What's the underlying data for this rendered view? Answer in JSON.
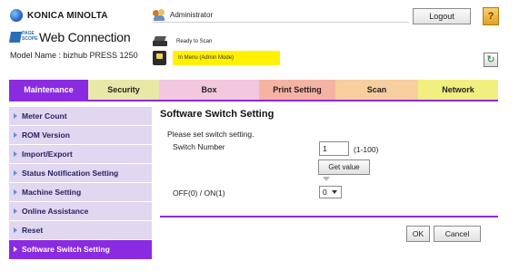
{
  "header": {
    "brand": "KONICA MINOLTA",
    "pagescope_logo": "PAGE SCOPE",
    "app_title": "Web Connection",
    "model_label": "Model Name : bizhub PRESS 1250",
    "user": "Administrator",
    "printer_status": "Ready to Scan",
    "menu_status": "In Menu (Admin Mode)",
    "logout_label": "Logout",
    "help_label": "?",
    "refresh_icon": "refresh-icon",
    "colors": {
      "menu_status_bg": "#fff200",
      "help_bg": "#e4a21e"
    }
  },
  "tabs": [
    {
      "label": "Maintenance",
      "color": "#8a2be2",
      "active": true
    },
    {
      "label": "Security",
      "color": "#e8e8a8"
    },
    {
      "label": "Box",
      "color": "#f3c7de"
    },
    {
      "label": "Print Setting",
      "color": "#f6b3a4"
    },
    {
      "label": "Scan",
      "color": "#f7ce9e"
    },
    {
      "label": "Network",
      "color": "#f1ef7f"
    }
  ],
  "sidebar": {
    "items": [
      {
        "label": "Meter Count"
      },
      {
        "label": "ROM Version"
      },
      {
        "label": "Import/Export"
      },
      {
        "label": "Status Notification Setting"
      },
      {
        "label": "Machine Setting"
      },
      {
        "label": "Online Assistance"
      },
      {
        "label": "Reset"
      },
      {
        "label": "Software Switch Setting",
        "active": true
      }
    ]
  },
  "main": {
    "title": "Software Switch Setting",
    "instruction": "Please set switch setting.",
    "switch_number_label": "Switch Number",
    "switch_number_value": "1",
    "switch_number_range": "(1-100)",
    "get_value_label": "Get value",
    "offon_label": "OFF(0) / ON(1)",
    "offon_value": "0",
    "ok_label": "OK",
    "cancel_label": "Cancel"
  },
  "accent_color": "#8a2be2"
}
